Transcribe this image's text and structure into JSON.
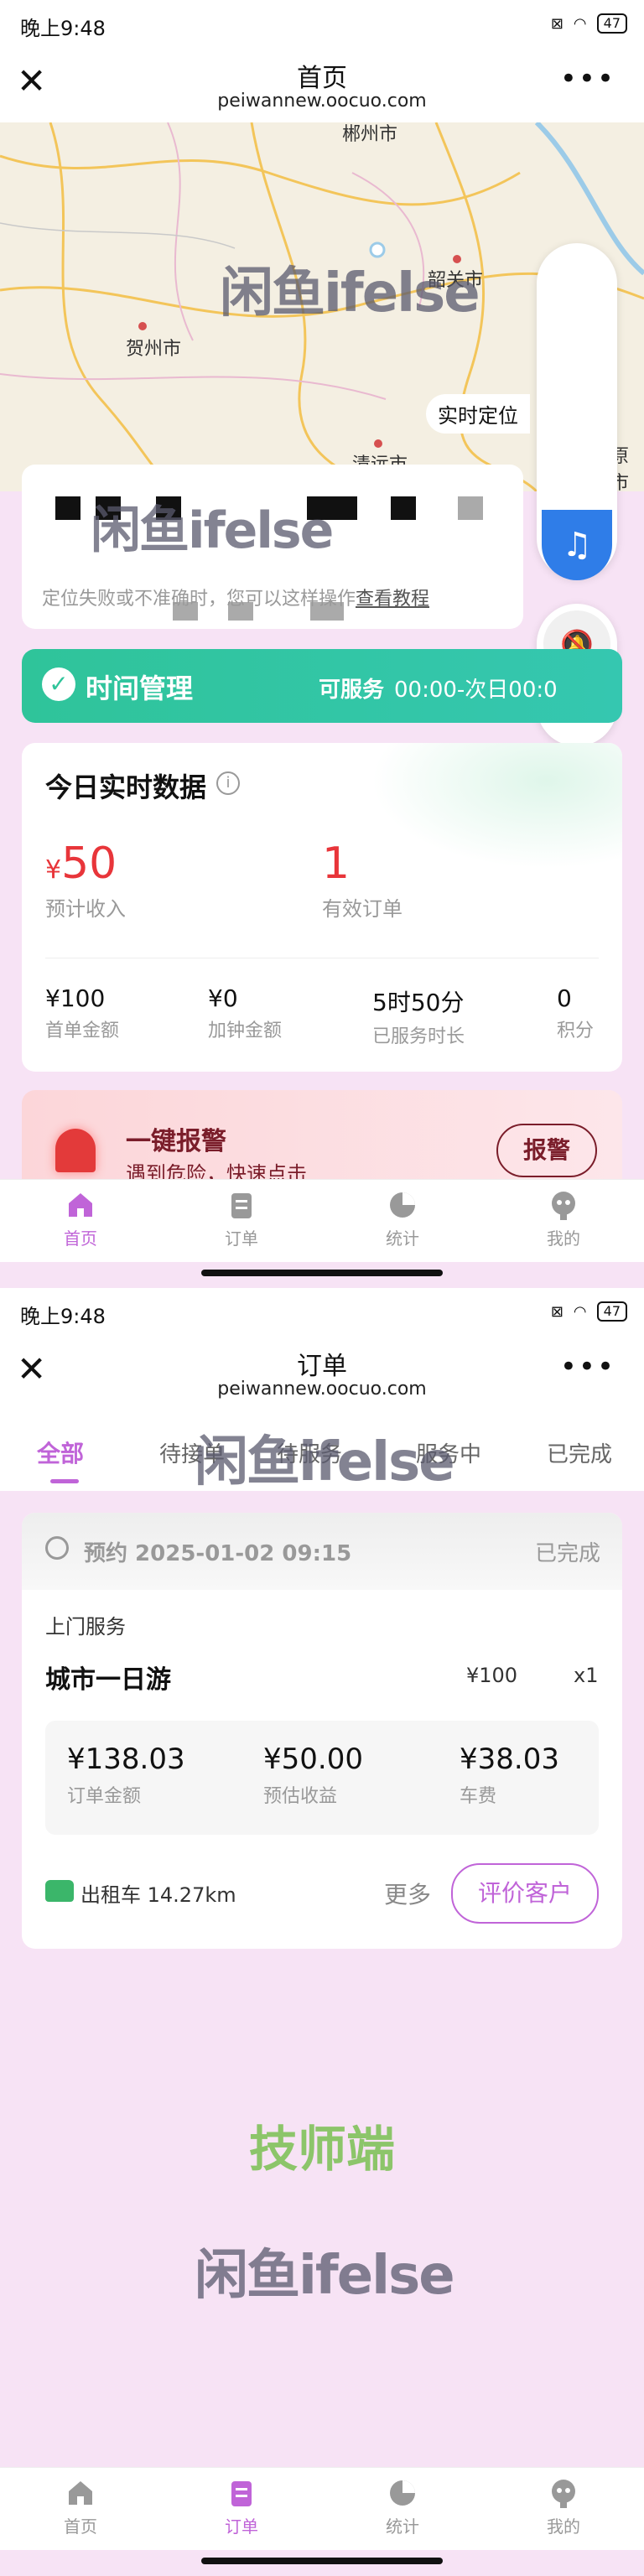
{
  "screen1": {
    "status": {
      "time": "晚上9:48",
      "battery": "47"
    },
    "nav": {
      "title": "首页",
      "subtitle": "peiwannew.oocuo.com"
    },
    "map": {
      "cities": [
        "郴州市",
        "贺州市",
        "韶关市",
        "清远市",
        "原市"
      ],
      "location_label": "实时定位"
    },
    "location_notice": {
      "text": "定位失败或不准确时，您可以这样操作",
      "link": "查看教程"
    },
    "time_management": {
      "label": "时间管理",
      "status": "可服务",
      "hours": "00:00-次日00:0"
    },
    "realtime": {
      "title": "今日实时数据",
      "big_stats": [
        {
          "value": "50",
          "prefix": "¥",
          "label": "预计收入"
        },
        {
          "value": "1",
          "label": "有效订单"
        }
      ],
      "small_stats": [
        {
          "value": "¥100",
          "label": "首单金额"
        },
        {
          "value": "¥0",
          "label": "加钟金额"
        },
        {
          "value": "5时50分",
          "label": "已服务时长"
        },
        {
          "value": "0",
          "label": "积分"
        }
      ]
    },
    "alarm": {
      "title": "一键报警",
      "subtitle": "遇到危险，快速点击",
      "button": "报警"
    },
    "watermark": "闲鱼ifelse"
  },
  "screen2": {
    "status": {
      "time": "晚上9:48",
      "battery": "47"
    },
    "nav": {
      "title": "订单",
      "subtitle": "peiwannew.oocuo.com"
    },
    "order_tabs": [
      "全部",
      "待接单",
      "待服务",
      "服务中",
      "已完成"
    ],
    "active_tab": "全部",
    "order": {
      "reserve_label": "预约 2025-01-02 09:15",
      "status": "已完成",
      "type": "上门服务",
      "service_name": "城市一日游",
      "service_price": "¥100",
      "quantity": "x1",
      "amounts": [
        {
          "value": "¥138.03",
          "label": "订单金额"
        },
        {
          "value": "¥50.00",
          "label": "预估收益"
        },
        {
          "value": "¥38.03",
          "label": "车费"
        }
      ],
      "transport": "出租车 14.27km",
      "more": "更多",
      "review_button": "评价客户"
    },
    "brand_text": "技师端",
    "watermark": "闲鱼ifelse"
  },
  "tabbar": {
    "items": [
      {
        "label": "首页",
        "icon": "home-icon"
      },
      {
        "label": "订单",
        "icon": "order-icon"
      },
      {
        "label": "统计",
        "icon": "pie-chart-icon"
      },
      {
        "label": "我的",
        "icon": "profile-icon"
      }
    ]
  },
  "colors": {
    "accent": "#c064d8",
    "green": "#36c79a",
    "red": "#e8353a"
  }
}
